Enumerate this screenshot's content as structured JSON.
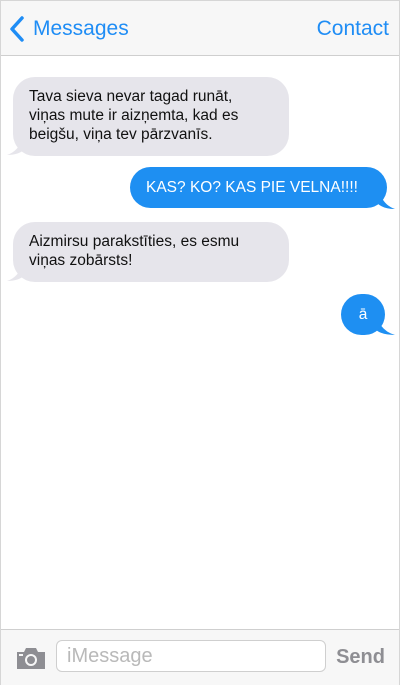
{
  "header": {
    "back_label": "Messages",
    "contact_label": "Contact"
  },
  "messages": [
    {
      "direction": "incoming",
      "lines": [
        "Tava sieva nevar tagad runāt,",
        "viņas mute ir aizņemta, kad es",
        "beigšu, viņa tev pārzvanīs."
      ]
    },
    {
      "direction": "outgoing",
      "lines": [
        "KAS? KO? KAS PIE VELNA!!!!"
      ]
    },
    {
      "direction": "incoming",
      "lines": [
        "Aizmirsu parakstīties, es esmu",
        "viņas zobārsts!"
      ]
    },
    {
      "direction": "outgoing",
      "lines": [
        "ā"
      ]
    }
  ],
  "composer": {
    "placeholder": "iMessage",
    "send_label": "Send"
  },
  "colors": {
    "accent": "#1f8df5",
    "incoming_bubble": "#e6e5eb",
    "outgoing_bubble": "#1e8ff2"
  }
}
